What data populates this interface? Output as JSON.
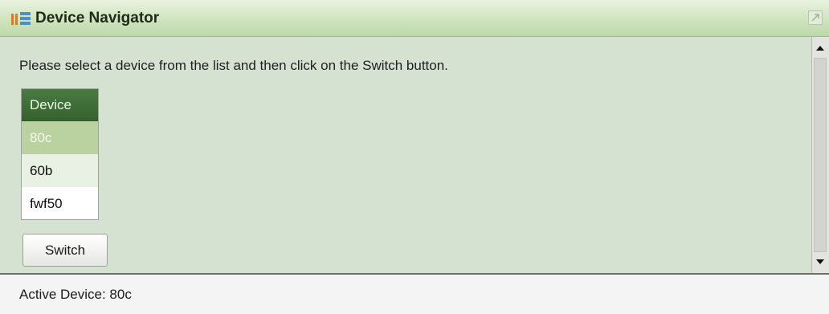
{
  "window": {
    "title": "Device Navigator",
    "icon": "device-navigator-icon",
    "maximize_icon": "maximize-icon"
  },
  "main": {
    "instruction": "Please select a device from the list and then click on the Switch button.",
    "grid": {
      "header": "Device",
      "rows": [
        "80c",
        "60b",
        "fwf50"
      ],
      "selected": "80c"
    },
    "switch_label": "Switch"
  },
  "status": {
    "active_device": "Active Device: 80c"
  },
  "colors": {
    "title_bar": "#cfe4bf",
    "content_bg": "#d5e2d2",
    "grid_header": "#3f6d38",
    "selected_row": "#b9d2a0"
  }
}
